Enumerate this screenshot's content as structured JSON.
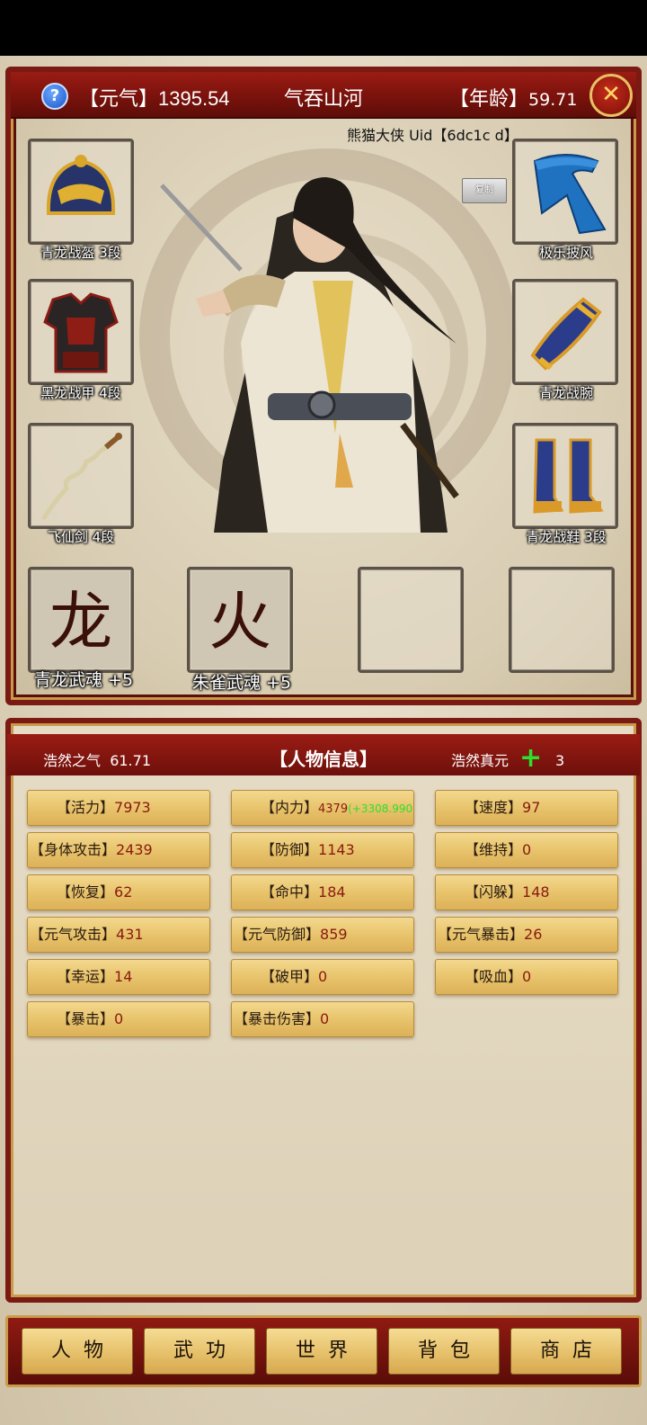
{
  "header": {
    "yuanqi_label": "【元气】",
    "yuanqi_value": "1395.54",
    "title": "气吞山河",
    "age_label": "【年龄】",
    "age_value": "59.71",
    "help_symbol": "?",
    "close_symbol": "✕"
  },
  "player": {
    "uid_text": "熊猫大侠 Uid【6dc1c d】",
    "copy_label": "复制"
  },
  "equipment": {
    "helmet": "青龙战盔 3段",
    "armor": "黑龙战甲 4段",
    "sword": "飞仙剑 4段",
    "cape": "极乐披风",
    "bracer": "青龙战腕",
    "boots": "青龙战鞋 3段"
  },
  "souls": {
    "soul1_label": "青龙武魂 +5",
    "soul2_label": "朱雀武魂 +5",
    "soul1_glyph": "龙",
    "soul2_glyph": "火"
  },
  "info": {
    "haoran_label": "浩然之气",
    "haoran_value": "61.71",
    "title": "【人物信息】",
    "zhenyuan_label": "浩然真元",
    "zhenyuan_value": "3",
    "plus_symbol": "+"
  },
  "stats": [
    {
      "k": "【活力】",
      "v": "7973"
    },
    {
      "k": "【内力】",
      "v": "4379",
      "bonus": "(+3308.990)"
    },
    {
      "k": "【速度】",
      "v": "97"
    },
    {
      "k": "【身体攻击】",
      "v": "2439"
    },
    {
      "k": "【防御】",
      "v": "1143"
    },
    {
      "k": "【维持】",
      "v": "0"
    },
    {
      "k": "【恢复】",
      "v": "62"
    },
    {
      "k": "【命中】",
      "v": "184"
    },
    {
      "k": "【闪躲】",
      "v": "148"
    },
    {
      "k": "【元气攻击】",
      "v": "431"
    },
    {
      "k": "【元气防御】",
      "v": "859"
    },
    {
      "k": "【元气暴击】",
      "v": "26"
    },
    {
      "k": "【幸运】",
      "v": "14"
    },
    {
      "k": "【破甲】",
      "v": "0"
    },
    {
      "k": "【吸血】",
      "v": "0"
    },
    {
      "k": "【暴击】",
      "v": "0"
    },
    {
      "k": "【暴击伤害】",
      "v": "0"
    }
  ],
  "nav": [
    "人物",
    "武功",
    "世界",
    "背包",
    "商店"
  ],
  "colors": {
    "frame_red": "#7a1a12",
    "gold": "#c89a4a",
    "stat_value": "#8a1a10",
    "bonus_green": "#2ee02e"
  }
}
